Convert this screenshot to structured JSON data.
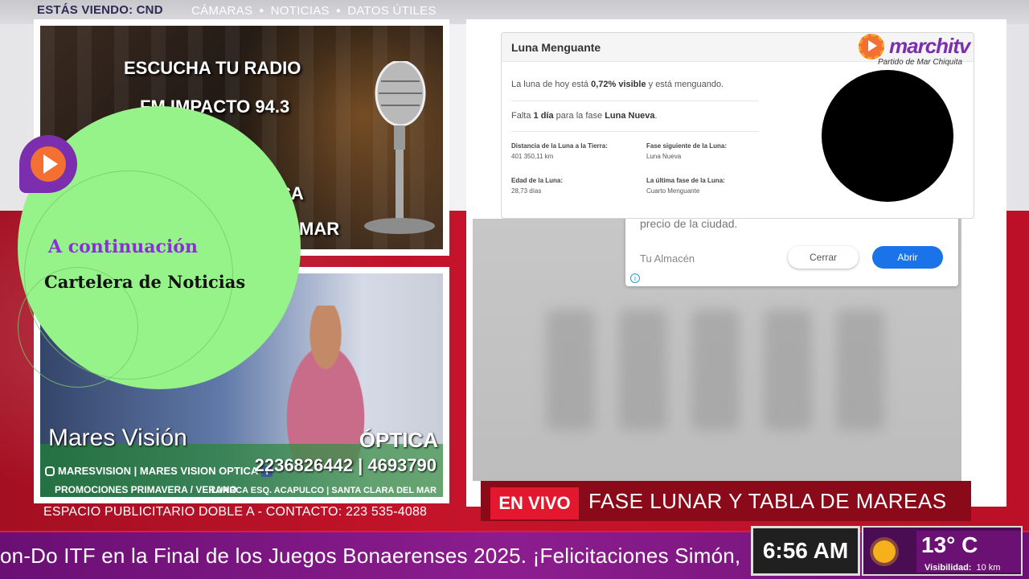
{
  "header": {
    "now_watching": "ESTÁS VIENDO: CND",
    "nav": [
      "CÁMARAS",
      "NOTICIAS",
      "DATOS ÚTILES"
    ]
  },
  "radio_ad": {
    "line1": "ESCUCHA TU RADIO",
    "line2": "FM IMPACTO 94.3",
    "line3": "CA",
    "line4": "MAR"
  },
  "optica_ad": {
    "brand": "Mares Visión",
    "word": "ÓPTICA",
    "social": "MARESVISION | MARES VISION OPTICA",
    "phones": "2236826442 | 4693790",
    "promo": "PROMOCIONES PRIMAVERA / VERANO",
    "address": "LUARCA ESQ. ACAPULCO | SANTA CLARA DEL MAR"
  },
  "ad_contact": "ESPACIO PUBLICITARIO DOBLE A - CONTACTO: 223 535-4088",
  "up_next": {
    "label": "A continuación",
    "show": "Cartelera de Noticias"
  },
  "moon_card": {
    "title": "Luna Menguante",
    "visible_pre": "La luna de hoy está ",
    "visible_pct": "0,72% visible",
    "visible_post": " y está menguando.",
    "missing_pre": "Falta ",
    "missing_days": "1 día",
    "missing_mid": " para la fase ",
    "missing_phase": "Luna Nueva",
    "missing_post": ".",
    "info": [
      {
        "label": "Distancia de la Luna a la Tierra:",
        "value": "401 350,11 km"
      },
      {
        "label": "Fase siguiente de la Luna:",
        "value": "Luna Nueva"
      },
      {
        "label": "Edad de la Luna:",
        "value": "28,73 días"
      },
      {
        "label": "La última fase de la Luna:",
        "value": "Cuarto Menguante"
      }
    ]
  },
  "logo": {
    "name": "marchitv",
    "subtitle": "Partido de Mar Chiquita"
  },
  "popup": {
    "text": "precio de la ciudad.",
    "brand": "Tu Almacén",
    "close_label": "Cerrar",
    "open_label": "Abrir",
    "info_icon": "i"
  },
  "live": {
    "tag": "EN VIVO",
    "title": "FASE LUNAR Y TABLA DE MAREAS"
  },
  "ticker": {
    "text": "on-Do ITF en la Final de los Juegos Bonaerenses 2025.  ¡Felicitaciones Simón,"
  },
  "clock": "6:56 AM",
  "weather": {
    "icon": "sun-icon",
    "temp": "13° C",
    "visibility_label": "Visibilidad:",
    "visibility_value": "10 km"
  },
  "colors": {
    "accent_purple": "#7b2fae",
    "live_red": "#e3182e",
    "ticker_purple": "#8c1d8e",
    "promo_green": "#96f38a"
  }
}
